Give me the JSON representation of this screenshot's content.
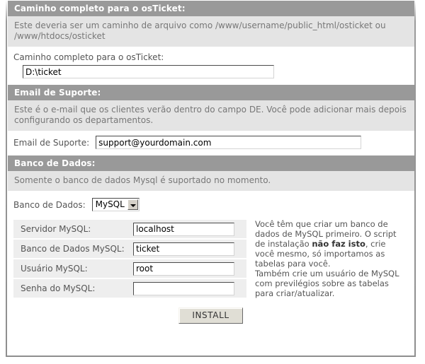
{
  "sections": [
    {
      "id": "path",
      "header": "Caminho completo para o osTicket:",
      "description": "Este deveria ser um caminho de arquivo como /www/username/public_html/osticket ou /www/htdocs/osticket",
      "field_label": "Caminho completo para o osTicket:",
      "field_value": "D:\\ticket"
    },
    {
      "id": "email",
      "header": "Email de Suporte:",
      "description": "Este é o e-mail que os clientes verão dentro do campo DE. Você pode adicionar mais depois configurando os departamentos.",
      "field_label": "Email de Suporte:",
      "field_value": "support@yourdomain.com"
    },
    {
      "id": "database",
      "header": "Banco de Dados:",
      "description": "Somente o banco de dados Mysql é suportado no momento."
    }
  ],
  "database": {
    "select_label": "Banco de Dados:",
    "select_value": "MySQL",
    "select_options": [
      "MySQL"
    ],
    "fields": [
      {
        "label": "Servidor MySQL:",
        "value": "localhost",
        "placeholder": ""
      },
      {
        "label": "Banco de Dados MySQL:",
        "value": "ticket",
        "placeholder": ""
      },
      {
        "label": "Usuário MySQL:",
        "value": "root",
        "placeholder": ""
      },
      {
        "label": "Senha do MySQL:",
        "value": "",
        "placeholder": ""
      }
    ],
    "help_paragraph_1_a": "Você têm que criar um banco de dados de MySQL primeiro. O script de instalação ",
    "help_paragraph_1_bold": "não faz isto",
    "help_paragraph_1_b": ", crie você mesmo, só importamos as tabelas para você.",
    "help_paragraph_2": "Também crie um usuário de MySQL com previlégios sobre as tabelas para criar/atualizar."
  },
  "actions": {
    "install_label": "INSTALL"
  },
  "colors": {
    "header_bar": "#999999",
    "description_bar": "#e4e4e4",
    "row_cell": "#eeeeee",
    "page_background": "#ffffff",
    "button_face": "#e0ded5",
    "label_text": "#555555"
  }
}
